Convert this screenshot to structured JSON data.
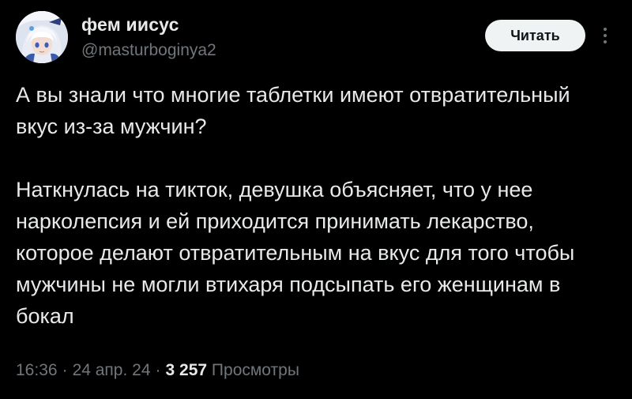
{
  "tweet": {
    "author": {
      "display_name": "фем иисус",
      "handle": "@masturboginya2",
      "avatar_icon": "anime-character-avatar"
    },
    "follow_button_label": "Читать",
    "more_icon": "more-vertical-icon",
    "body": {
      "paragraph_1": "А вы знали что многие таблетки имеют отвратительный вкус из-за мужчин?",
      "paragraph_2": "Наткнулась на тикток, девушка объясняет, что у нее нарколепсия и ей приходится принимать лекарство, которое делают отвратительным на вкус для того чтобы мужчины не могли втихаря подсыпать его женщинам в бокал"
    },
    "meta": {
      "time": "16:36",
      "separator": "·",
      "date": "24 апр. 24",
      "views_count": "3 257",
      "views_label": "Просмотры"
    }
  },
  "colors": {
    "background": "#000000",
    "primary_text": "#e7e9ea",
    "secondary_text": "#71767b",
    "button_bg": "#eff3f4",
    "button_text": "#0f1419"
  }
}
